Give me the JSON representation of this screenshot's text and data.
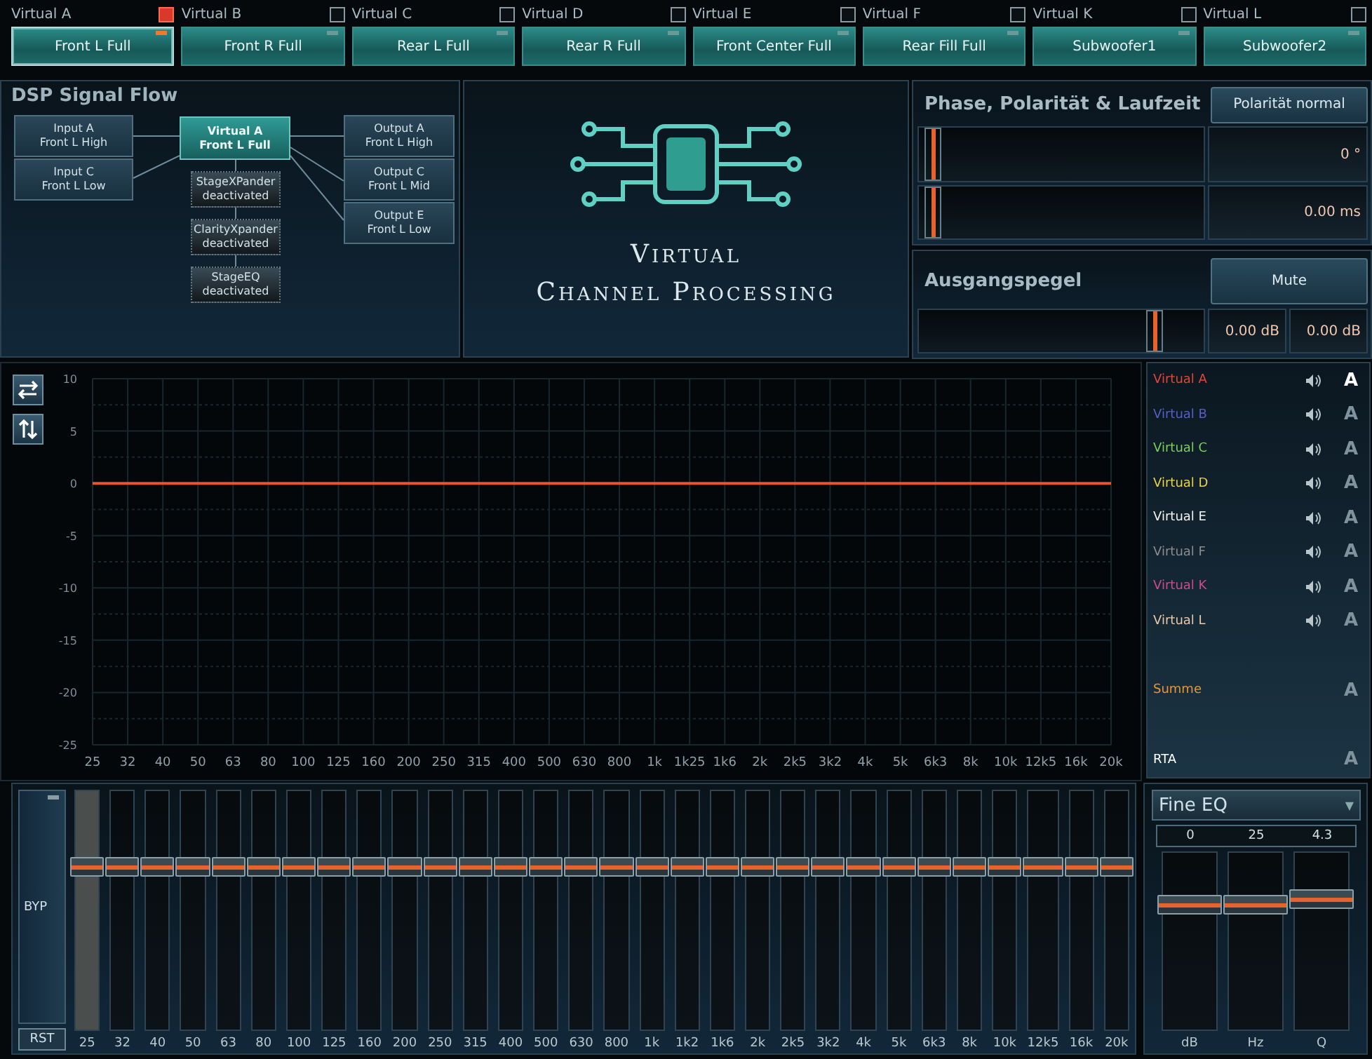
{
  "channels": [
    {
      "label": "Virtual A",
      "checked": true,
      "button": "Front L Full",
      "selected": true
    },
    {
      "label": "Virtual B",
      "checked": false,
      "button": "Front R Full",
      "selected": false
    },
    {
      "label": "Virtual C",
      "checked": false,
      "button": "Rear L Full",
      "selected": false
    },
    {
      "label": "Virtual D",
      "checked": false,
      "button": "Rear R Full",
      "selected": false
    },
    {
      "label": "Virtual E",
      "checked": false,
      "button": "Front Center Full",
      "selected": false
    },
    {
      "label": "Virtual F",
      "checked": false,
      "button": "Rear Fill Full",
      "selected": false
    },
    {
      "label": "Virtual K",
      "checked": false,
      "button": "Subwoofer1",
      "selected": false
    },
    {
      "label": "Virtual L",
      "checked": false,
      "button": "Subwoofer2",
      "selected": false
    }
  ],
  "signal_flow": {
    "title": "DSP Signal Flow",
    "inputs": [
      {
        "name": "Input A",
        "assignment": "Front L High"
      },
      {
        "name": "Input C",
        "assignment": "Front L Low"
      }
    ],
    "virtual": {
      "name": "Virtual A",
      "assignment": "Front L Full"
    },
    "modules": [
      {
        "name": "StageXPander",
        "status": "deactivated"
      },
      {
        "name": "ClarityXpander",
        "status": "deactivated"
      },
      {
        "name": "StageEQ",
        "status": "deactivated"
      }
    ],
    "outputs": [
      {
        "name": "Output A",
        "assignment": "Front L High"
      },
      {
        "name": "Output C",
        "assignment": "Front L Mid"
      },
      {
        "name": "Output E",
        "assignment": "Front L Low"
      }
    ]
  },
  "logo": {
    "title_lines": [
      "Virtual",
      "Channel Processing"
    ]
  },
  "phase": {
    "title": "Phase, Polarität & Laufzeit",
    "polarity_button": "Polarität normal",
    "sliders": [
      {
        "level": 0.02,
        "reading": "0 °"
      },
      {
        "level": 0.02,
        "reading": "0.00 ms"
      }
    ]
  },
  "output_level": {
    "title": "Ausgangspegel",
    "mute_button": "Mute",
    "level": 0.85,
    "readings": [
      "0.00 dB",
      "0.00 dB"
    ]
  },
  "graph": {
    "chart_data": {
      "type": "line",
      "categories": [
        "25",
        "32",
        "40",
        "50",
        "63",
        "80",
        "100",
        "125",
        "160",
        "200",
        "250",
        "315",
        "400",
        "500",
        "630",
        "800",
        "1k",
        "1k25",
        "1k6",
        "2k",
        "2k5",
        "3k2",
        "4k",
        "5k",
        "6k3",
        "8k",
        "10k",
        "12k5",
        "16k",
        "20k"
      ],
      "ylim": [
        -25,
        10
      ],
      "grid": true,
      "yticks": [
        10,
        5,
        0,
        -5,
        -10,
        -15,
        -20,
        -25
      ],
      "series": [
        {
          "color": "#e2572b",
          "values": [
            0,
            0,
            0,
            0,
            0,
            0,
            0,
            0,
            0,
            0,
            0,
            0,
            0,
            0,
            0,
            0,
            0,
            0,
            0,
            0,
            0,
            0,
            0,
            0,
            0,
            0,
            0,
            0,
            0,
            0
          ]
        }
      ]
    }
  },
  "legend": [
    {
      "kind": "channel",
      "name": "Virtual A",
      "color": "#e0473a",
      "selected": true,
      "toggle": "A"
    },
    {
      "kind": "channel",
      "name": "Virtual B",
      "color": "#5a5fc8",
      "selected": false,
      "toggle": "A"
    },
    {
      "kind": "channel",
      "name": "Virtual C",
      "color": "#7ccf5a",
      "selected": false,
      "toggle": "A"
    },
    {
      "kind": "channel",
      "name": "Virtual D",
      "color": "#e8d24a",
      "selected": false,
      "toggle": "A"
    },
    {
      "kind": "channel",
      "name": "Virtual E",
      "color": "#f2f2f2",
      "selected": false,
      "toggle": "A"
    },
    {
      "kind": "channel",
      "name": "Virtual F",
      "color": "#8c8c8c",
      "selected": false,
      "toggle": "A"
    },
    {
      "kind": "channel",
      "name": "Virtual K",
      "color": "#d04a8a",
      "selected": false,
      "toggle": "A"
    },
    {
      "kind": "channel",
      "name": "Virtual L",
      "color": "#e6c9a8",
      "selected": false,
      "toggle": "A"
    },
    {
      "kind": "total",
      "name": "Summe",
      "color": "#e8962e",
      "selected": false,
      "toggle": "A"
    },
    {
      "kind": "total",
      "name": "RTA",
      "color": "#ffffff",
      "selected": false,
      "toggle": "A"
    }
  ],
  "graphic_eq": {
    "bypass": "BYP",
    "reset": "RST",
    "bands": [
      {
        "label": "25",
        "level": 0.7,
        "selected": true
      },
      {
        "label": "32",
        "level": 0.7,
        "selected": false
      },
      {
        "label": "40",
        "level": 0.7,
        "selected": false
      },
      {
        "label": "50",
        "level": 0.7,
        "selected": false
      },
      {
        "label": "63",
        "level": 0.7,
        "selected": false
      },
      {
        "label": "80",
        "level": 0.7,
        "selected": false
      },
      {
        "label": "100",
        "level": 0.7,
        "selected": false
      },
      {
        "label": "125",
        "level": 0.7,
        "selected": false
      },
      {
        "label": "160",
        "level": 0.7,
        "selected": false
      },
      {
        "label": "200",
        "level": 0.7,
        "selected": false
      },
      {
        "label": "250",
        "level": 0.7,
        "selected": false
      },
      {
        "label": "315",
        "level": 0.7,
        "selected": false
      },
      {
        "label": "400",
        "level": 0.7,
        "selected": false
      },
      {
        "label": "500",
        "level": 0.7,
        "selected": false
      },
      {
        "label": "630",
        "level": 0.7,
        "selected": false
      },
      {
        "label": "800",
        "level": 0.7,
        "selected": false
      },
      {
        "label": "1k",
        "level": 0.7,
        "selected": false
      },
      {
        "label": "1k2",
        "level": 0.7,
        "selected": false
      },
      {
        "label": "1k6",
        "level": 0.7,
        "selected": false
      },
      {
        "label": "2k",
        "level": 0.7,
        "selected": false
      },
      {
        "label": "2k5",
        "level": 0.7,
        "selected": false
      },
      {
        "label": "3k2",
        "level": 0.7,
        "selected": false
      },
      {
        "label": "4k",
        "level": 0.7,
        "selected": false
      },
      {
        "label": "5k",
        "level": 0.7,
        "selected": false
      },
      {
        "label": "6k3",
        "level": 0.7,
        "selected": false
      },
      {
        "label": "8k",
        "level": 0.7,
        "selected": false
      },
      {
        "label": "10k",
        "level": 0.7,
        "selected": false
      },
      {
        "label": "12k5",
        "level": 0.7,
        "selected": false
      },
      {
        "label": "16k",
        "level": 0.7,
        "selected": false
      },
      {
        "label": "20k",
        "level": 0.7,
        "selected": false
      }
    ]
  },
  "fine_eq": {
    "mode": "Fine EQ",
    "caret": "▼",
    "params": [
      {
        "value": "0",
        "label": "dB",
        "level": 0.73
      },
      {
        "value": "25",
        "label": "Hz",
        "level": 0.73
      },
      {
        "value": "4.3",
        "label": "Q",
        "level": 0.77
      }
    ]
  }
}
